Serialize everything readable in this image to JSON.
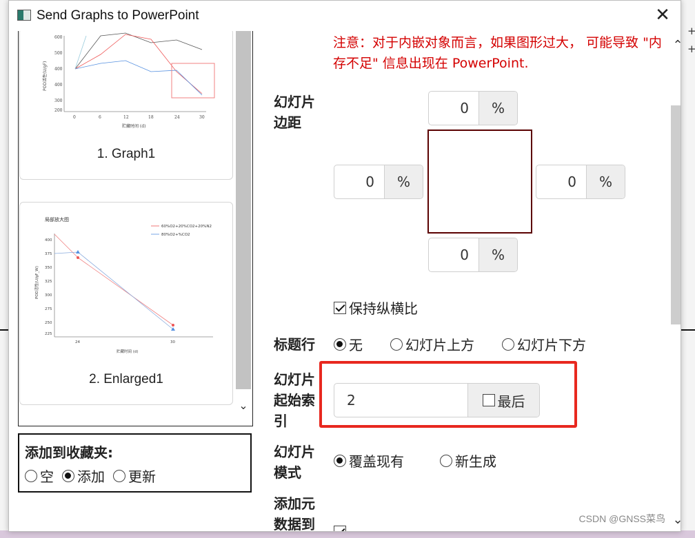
{
  "window": {
    "title": "Send Graphs to PowerPoint",
    "close_glyph": "✕"
  },
  "graphs": [
    {
      "caption": "1. Graph1"
    },
    {
      "caption": "2. Enlarged1",
      "thumb_title": "局部放大图",
      "legend": [
        "60%O2+20%CO2+20%N2",
        "80%O2+%CO2"
      ]
    }
  ],
  "favorites": {
    "title": "添加到收藏夹:",
    "options": [
      {
        "label": "空",
        "selected": false
      },
      {
        "label": "添加",
        "selected": true
      },
      {
        "label": "更新",
        "selected": false
      }
    ]
  },
  "warning": "注意：对于内嵌对象而言，如果图形过大， 可能导致 \"内存不足\" 信息出现在 PowerPoint.",
  "margins": {
    "label": "幻灯片边距",
    "top": "0",
    "left": "0",
    "right": "0",
    "bottom": "0",
    "unit": "%"
  },
  "keep_aspect": {
    "label": "保持纵横比",
    "checked": true
  },
  "title_row": {
    "label": "标题行",
    "options": [
      {
        "label": "无",
        "selected": true
      },
      {
        "label": "幻灯片上方",
        "selected": false
      },
      {
        "label": "幻灯片下方",
        "selected": false
      }
    ]
  },
  "start_index": {
    "label": "幻灯片起始索引",
    "value": "2",
    "last_label": "最后",
    "last_checked": false
  },
  "slide_mode": {
    "label": "幻灯片模式",
    "options": [
      {
        "label": "覆盖现有",
        "selected": true
      },
      {
        "label": "新生成",
        "selected": false
      }
    ]
  },
  "metadata": {
    "label": "添加元数据到"
  },
  "watermark": "CSDN @GNSS菜鸟",
  "colors": {
    "warning": "#d40000",
    "highlight": "#e8281f"
  }
}
